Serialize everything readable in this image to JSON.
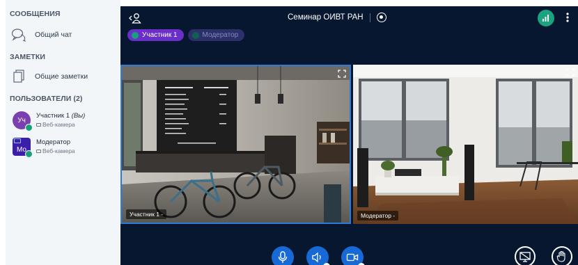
{
  "sidebar": {
    "messages_title": "СООБЩЕНИЯ",
    "public_chat_label": "Общий чат",
    "notes_title": "ЗАМЕТКИ",
    "shared_notes_label": "Общие заметки",
    "users_title": "ПОЛЬЗОВАТЕЛИ (2)",
    "users": [
      {
        "initials": "Уч",
        "name": "Участник 1",
        "self_tag": "(Вы)",
        "status": "Веб-камера",
        "avatar_color": "#7b3fb0"
      },
      {
        "initials": "Mo",
        "name": "Модератор",
        "self_tag": "",
        "status": "Веб-камера",
        "avatar_color": "#3b1fa8"
      }
    ]
  },
  "header": {
    "title": "Семинар ОИВТ РАН"
  },
  "talking": [
    {
      "name": "Участник 1",
      "active": true
    },
    {
      "name": "Модератор",
      "active": false
    }
  ],
  "videos": [
    {
      "label": "Участник 1 -"
    },
    {
      "label": "Модератор -"
    }
  ],
  "controls": {
    "mic_icon": "microphone-icon",
    "audio_icon": "speaker-icon",
    "camera_icon": "camera-icon",
    "screenshare_icon": "screen-share-off-icon",
    "raise_hand_icon": "hand-icon"
  },
  "colors": {
    "main_bg": "#06172f",
    "accent_blue": "#176ad6",
    "talk_active": "#6a2ec9",
    "status_green": "#1aa37f"
  }
}
